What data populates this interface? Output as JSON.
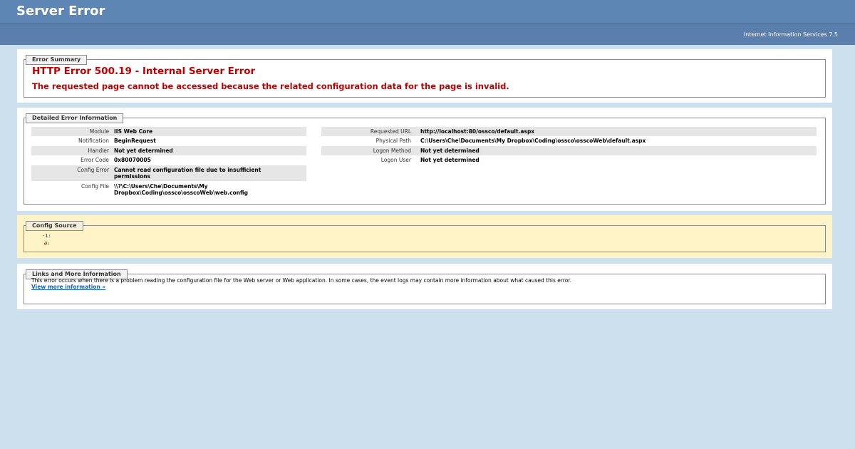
{
  "header": {
    "title": "Server Error",
    "server_version": "Internet Information Services 7.5"
  },
  "summary": {
    "legend": "Error Summary",
    "error_title": "HTTP Error 500.19 - Internal Server Error",
    "error_description": "The requested page cannot be accessed because the related configuration data for the page is invalid."
  },
  "detail": {
    "legend": "Detailed Error Information",
    "left": [
      {
        "label": "Module",
        "value": "IIS Web Core"
      },
      {
        "label": "Notification",
        "value": "BeginRequest"
      },
      {
        "label": "Handler",
        "value": "Not yet determined"
      },
      {
        "label": "Error Code",
        "value": "0x80070005"
      },
      {
        "label": "Config Error",
        "value": "Cannot read configuration file due to insufficient",
        "value_line2": "permissions"
      },
      {
        "label": "Config File",
        "value": "\\\\?\\C:\\Users\\Che\\Documents\\My",
        "value_line2": "Dropbox\\Coding\\ossco\\osscoWeb\\web.config"
      }
    ],
    "right": [
      {
        "label": "Requested URL",
        "value": "http://localhost:80/ossco/default.aspx"
      },
      {
        "label": "Physical Path",
        "value": "C:\\Users\\Che\\Documents\\My Dropbox\\Coding\\ossco\\osscoWeb\\default.aspx"
      },
      {
        "label": "Logon Method",
        "value": "Not yet determined"
      },
      {
        "label": "Logon User",
        "value": "Not yet determined"
      }
    ]
  },
  "config_source": {
    "legend": "Config Source",
    "lines": [
      {
        "text": "-1:",
        "color": "#333333"
      },
      {
        "text": "0:",
        "color": "#c00000"
      }
    ]
  },
  "links": {
    "legend": "Links and More Information",
    "text": "This error occurs when there is a problem reading the configuration file for the Web server or Web application. In some cases, the event logs may contain more information about what caused this error.",
    "link_label": "View more information »"
  },
  "colors": {
    "header_bg": "#5d86b4",
    "page_bg": "#cde0ee",
    "error_red": "#c00000",
    "config_bg": "#fff3c8",
    "link_blue": "#1565c0"
  }
}
